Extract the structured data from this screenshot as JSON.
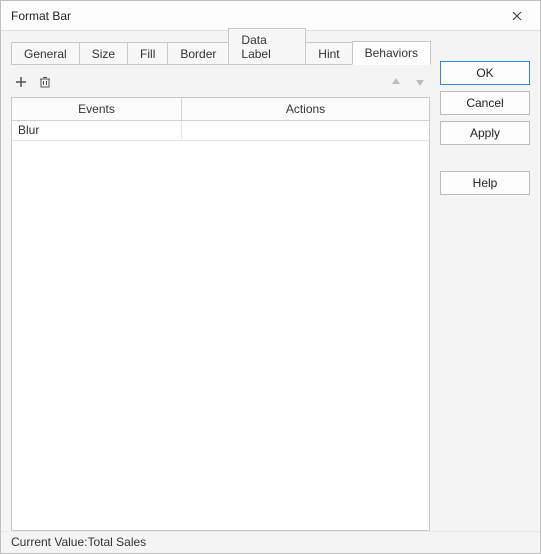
{
  "title": "Format Bar",
  "tabs": [
    {
      "label": "General"
    },
    {
      "label": "Size"
    },
    {
      "label": "Fill"
    },
    {
      "label": "Border"
    },
    {
      "label": "Data Label"
    },
    {
      "label": "Hint"
    },
    {
      "label": "Behaviors"
    }
  ],
  "active_tab_index": 6,
  "columns": {
    "events": "Events",
    "actions": "Actions"
  },
  "rows": [
    {
      "event": "Blur",
      "action": ""
    }
  ],
  "buttons": {
    "ok": "OK",
    "cancel": "Cancel",
    "apply": "Apply",
    "help": "Help"
  },
  "footer": {
    "label": "Current Value:",
    "value": "Total Sales"
  }
}
